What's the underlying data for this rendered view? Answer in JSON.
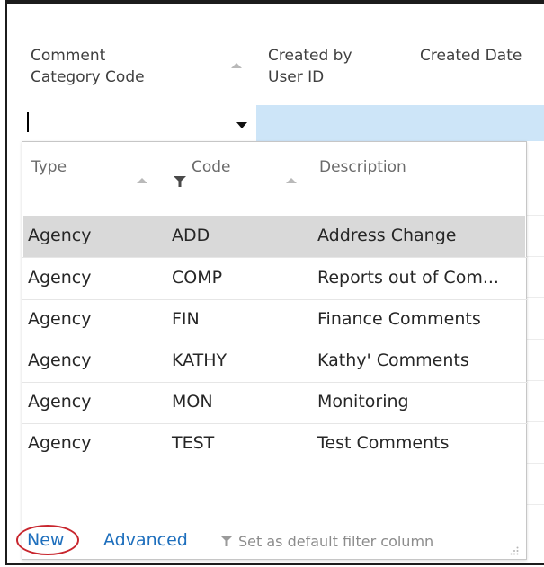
{
  "grid": {
    "headers": {
      "comment_category_code_line1": "Comment",
      "comment_category_code_line2": "Category Code",
      "created_by_line1": "Created by",
      "created_by_line2": "User ID",
      "created_date": "Created Date"
    },
    "filter_input_value": ""
  },
  "lookup": {
    "headers": {
      "type": "Type",
      "code": "Code",
      "description": "Description"
    },
    "rows": [
      {
        "type": "Agency",
        "code": "ADD",
        "description": "Address Change"
      },
      {
        "type": "Agency",
        "code": "COMP",
        "description": "Reports out of Com..."
      },
      {
        "type": "Agency",
        "code": "FIN",
        "description": "Finance Comments"
      },
      {
        "type": "Agency",
        "code": "KATHY",
        "description": "Kathy' Comments"
      },
      {
        "type": "Agency",
        "code": "MON",
        "description": "Monitoring"
      },
      {
        "type": "Agency",
        "code": "TEST",
        "description": "Test Comments"
      }
    ],
    "selected_row": 0,
    "footer": {
      "new_label": "New",
      "advanced_label": "Advanced",
      "default_filter_label": "Set as default filter column"
    }
  },
  "colors": {
    "filter_bar": "#cde5f8",
    "selected_row": "#d9d9d9",
    "link": "#1e6fbd",
    "highlight_circle": "#c8262e"
  },
  "icons": [
    "sort-ascending-icon",
    "filter-icon",
    "dropdown-arrow-icon",
    "resize-grip-icon"
  ]
}
